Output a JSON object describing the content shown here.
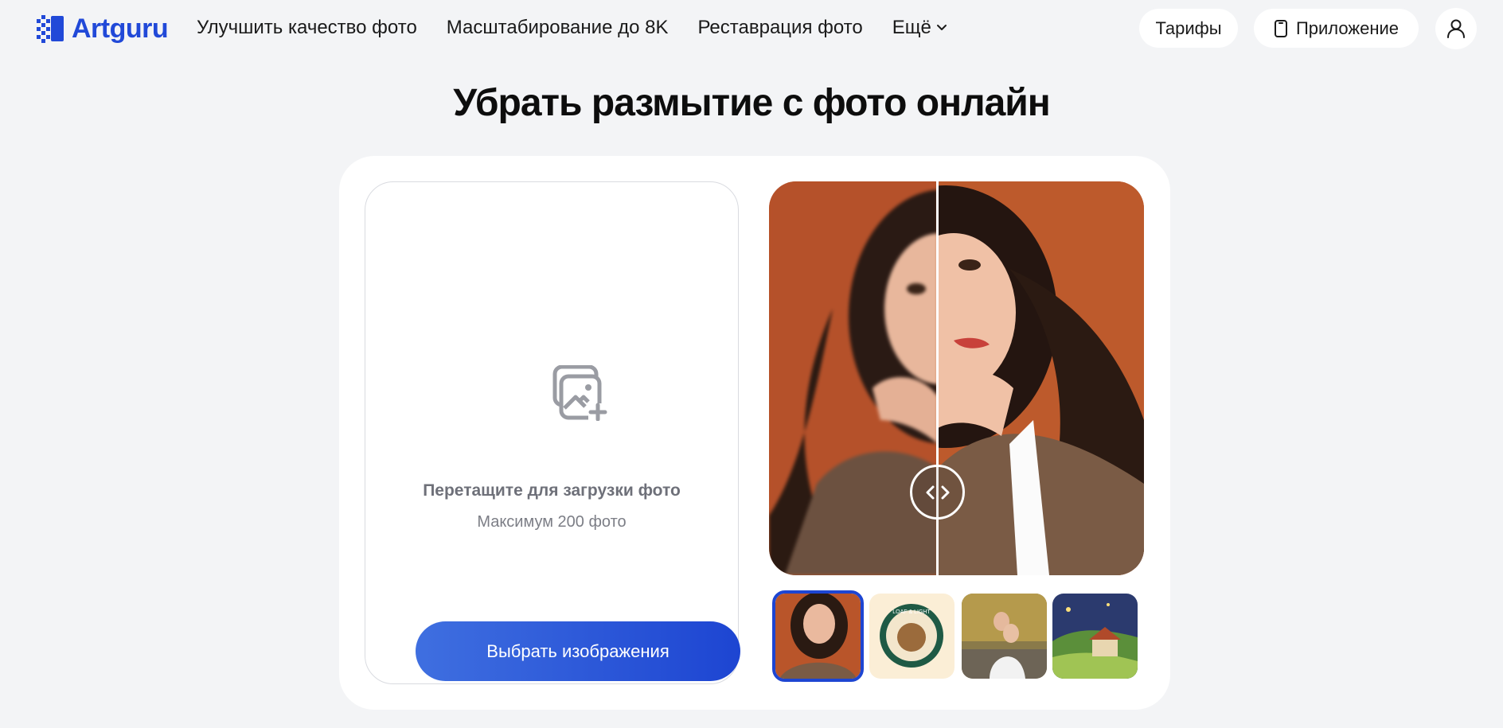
{
  "header": {
    "logo_text": "Artguru",
    "nav": [
      "Улучшить качество фото",
      "Масштабирование до 8K",
      "Реставрация фото"
    ],
    "more_label": "Ещё",
    "tariffs_label": "Тарифы",
    "app_label": "Приложение"
  },
  "page": {
    "title": "Убрать размытие с фото онлайн"
  },
  "upload": {
    "title": "Перетащите для загрузки фото",
    "subtitle": "Максимум 200 фото",
    "button_label": "Выбрать изображения"
  },
  "thumbnails": {
    "logo_text": "LOAF & LIGHT"
  },
  "colors": {
    "brand": "#2149d8",
    "button_gradient_start": "#3f6fe0",
    "button_gradient_end": "#1d45d2",
    "background": "#f3f4f6"
  },
  "icons": {
    "upload": "image-add-icon",
    "more": "chevron-down-icon",
    "app": "phone-icon",
    "user": "user-icon",
    "compare": "left-right-arrows-icon"
  }
}
